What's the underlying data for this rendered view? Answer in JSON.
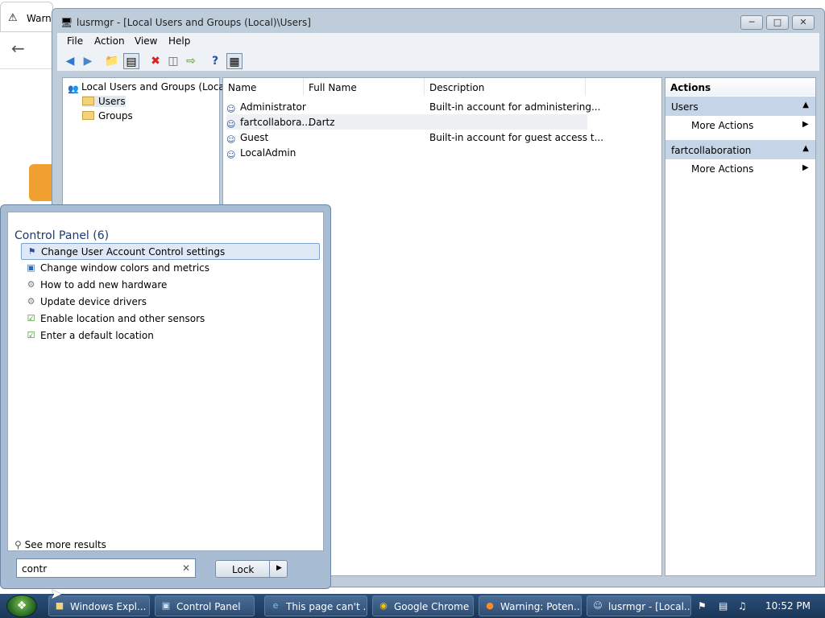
{
  "background_window": {
    "tab_title": "Warni"
  },
  "mmc": {
    "title": "lusrmgr - [Local Users and Groups (Local)\\Users]",
    "menu": [
      "File",
      "Action",
      "View",
      "Help"
    ],
    "tree": {
      "root": "Local Users and Groups (Local)",
      "children": [
        "Users",
        "Groups"
      ]
    },
    "list": {
      "columns": [
        "Name",
        "Full Name",
        "Description"
      ],
      "rows": [
        {
          "name": "Administrator",
          "full_name": "",
          "description": "Built-in account for administering..."
        },
        {
          "name": "fartcollabora...",
          "full_name": "Dartz",
          "description": ""
        },
        {
          "name": "Guest",
          "full_name": "",
          "description": "Built-in account for guest access t..."
        },
        {
          "name": "LocalAdmin",
          "full_name": "",
          "description": ""
        }
      ]
    },
    "actions": {
      "header": "Actions",
      "sections": [
        {
          "title": "Users",
          "item": "More Actions"
        },
        {
          "title": "fartcollaboration",
          "item": "More Actions"
        }
      ]
    }
  },
  "start_menu": {
    "group_header": "Control Panel (6)",
    "items": [
      "Change User Account Control settings",
      "Change window colors and metrics",
      "How to add new hardware",
      "Update device drivers",
      "Enable location and other sensors",
      "Enter a default location"
    ],
    "see_more": "See more results",
    "search_value": "contr",
    "lock_label": "Lock"
  },
  "taskbar": {
    "tasks": [
      "Windows Expl...",
      "Control Panel",
      "This page can't ...",
      "Google Chrome",
      "Warning: Poten...",
      "lusrmgr - [Local..."
    ],
    "clock": "10:52 PM"
  },
  "colors": {
    "taskbar": "#2b4f7a",
    "start_menu_frame": "#a8bdd4",
    "selection_highlight": "#dfe9f5",
    "actions_section": "#c5d4e6"
  }
}
